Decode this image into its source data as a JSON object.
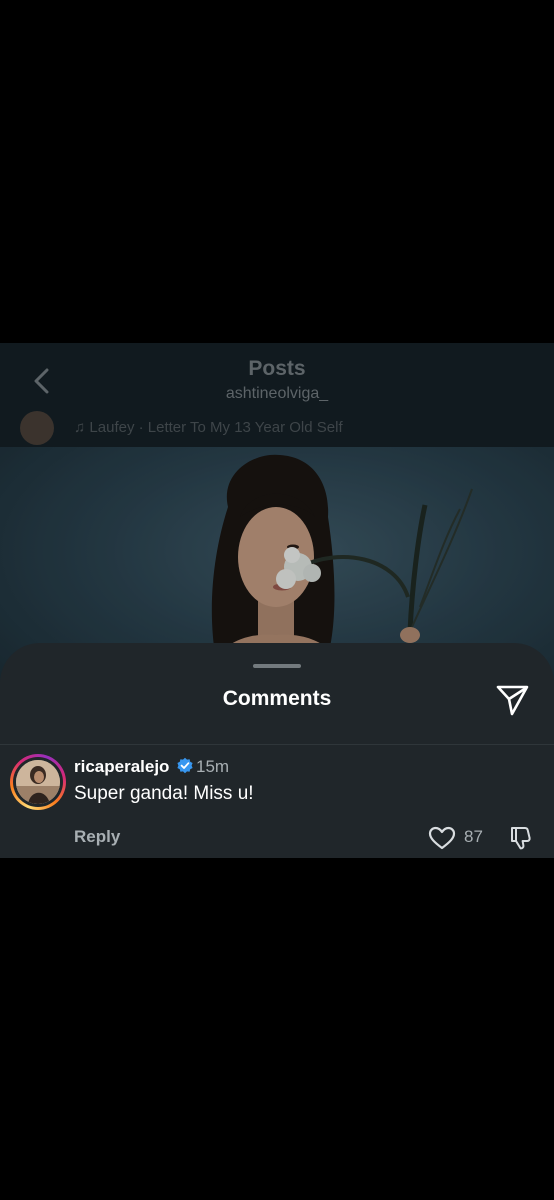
{
  "header": {
    "title": "Posts",
    "subtitle": "ashtineolviga_",
    "back_icon": "chevron-left-icon"
  },
  "post": {
    "audio_text": "♫ Laufey · Letter To My 13 Year Old Self",
    "image_description_icon": "post-photo"
  },
  "comments_sheet": {
    "title": "Comments",
    "share_icon": "paper-plane-icon",
    "comments": [
      {
        "username": "ricaperalejo",
        "verified": true,
        "time": "15m",
        "text": "Super ganda! Miss u!",
        "reply_label": "Reply",
        "like_count": "87",
        "like_icon": "heart-outline-icon",
        "dislike_icon": "thumbs-down-icon"
      }
    ]
  },
  "colors": {
    "background": "#000000",
    "sheet": "#20262a",
    "verified_badge": "#3897f0",
    "muted_text": "#a8afb3"
  }
}
